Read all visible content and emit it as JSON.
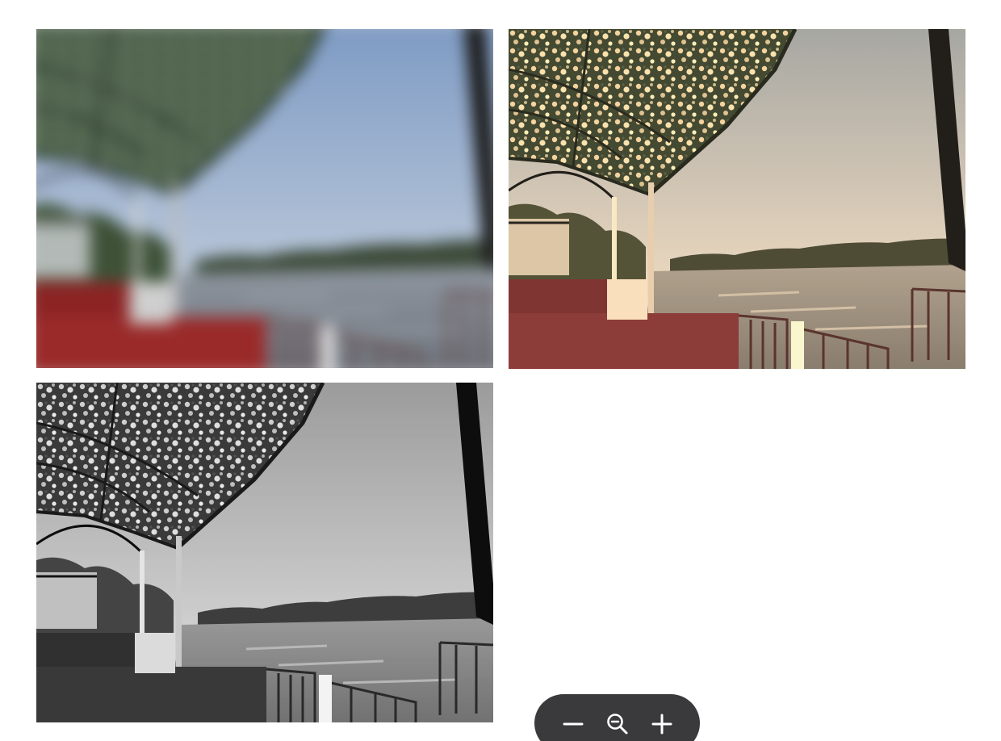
{
  "gallery": {
    "tiles": [
      {
        "name": "blurred-photo",
        "filter": "blur"
      },
      {
        "name": "warm-toned-photo",
        "filter": "warm"
      },
      {
        "name": "grayscale-photo",
        "filter": "grayscale"
      }
    ]
  },
  "zoom_controls": {
    "buttons": [
      {
        "name": "zoom-out-button",
        "icon": "minus-icon"
      },
      {
        "name": "zoom-reset-button",
        "icon": "magnifier-minus-icon"
      },
      {
        "name": "zoom-in-button",
        "icon": "plus-icon"
      }
    ]
  },
  "colors": {
    "toolbar_background": "#3a3a3c",
    "toolbar_icon": "#ffffff",
    "page_background": "#ffffff"
  }
}
